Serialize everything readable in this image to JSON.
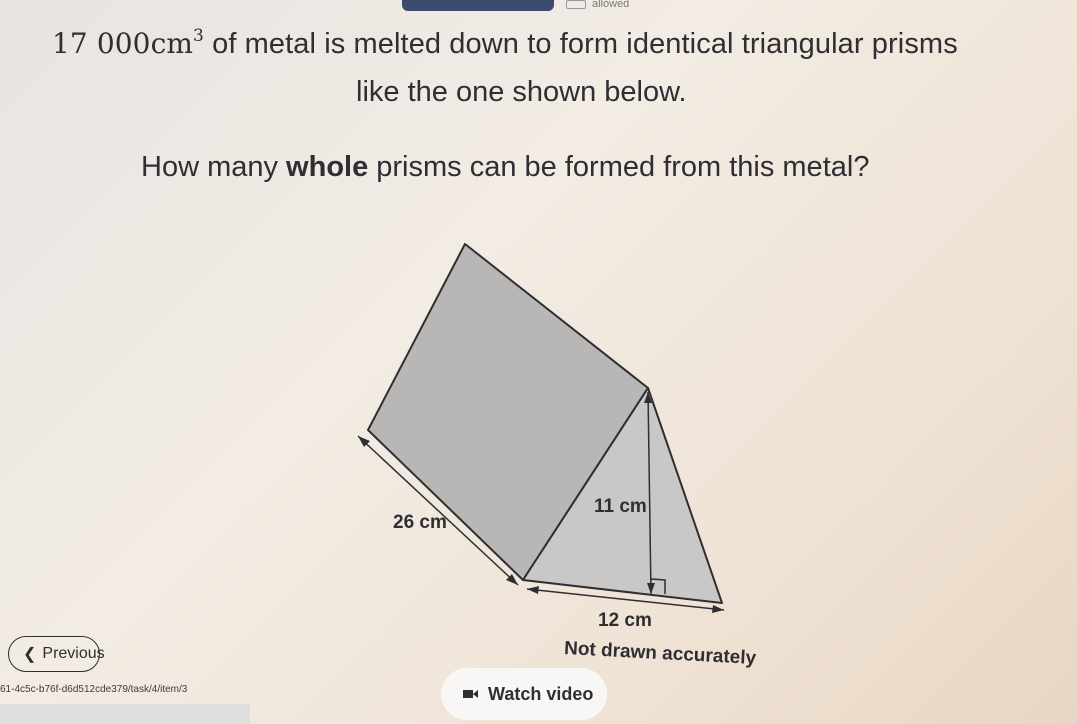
{
  "header": {
    "allowed_label": "allowed"
  },
  "question": {
    "volume_value": "17 000",
    "volume_unit": "cm",
    "volume_power": "3",
    "line1_rest": " of metal is melted down to form identical triangular prisms",
    "line2": "like the one shown below.",
    "main_before": "How many ",
    "main_bold": "whole",
    "main_after": " prisms can be formed from this metal?"
  },
  "diagram": {
    "length_label": "26 cm",
    "height_label": "11 cm",
    "base_label": "12 cm",
    "note": "Not drawn accurately"
  },
  "footer": {
    "previous_label": "Previous",
    "watch_video_label": "Watch video",
    "url_text": "61-4c5c-b76f-d6d512cde379/task/4/item/3"
  },
  "colors": {
    "rect_face": "#b9b7b6",
    "triangle_face": "#cac8c7",
    "outline": "#2f2e33"
  }
}
